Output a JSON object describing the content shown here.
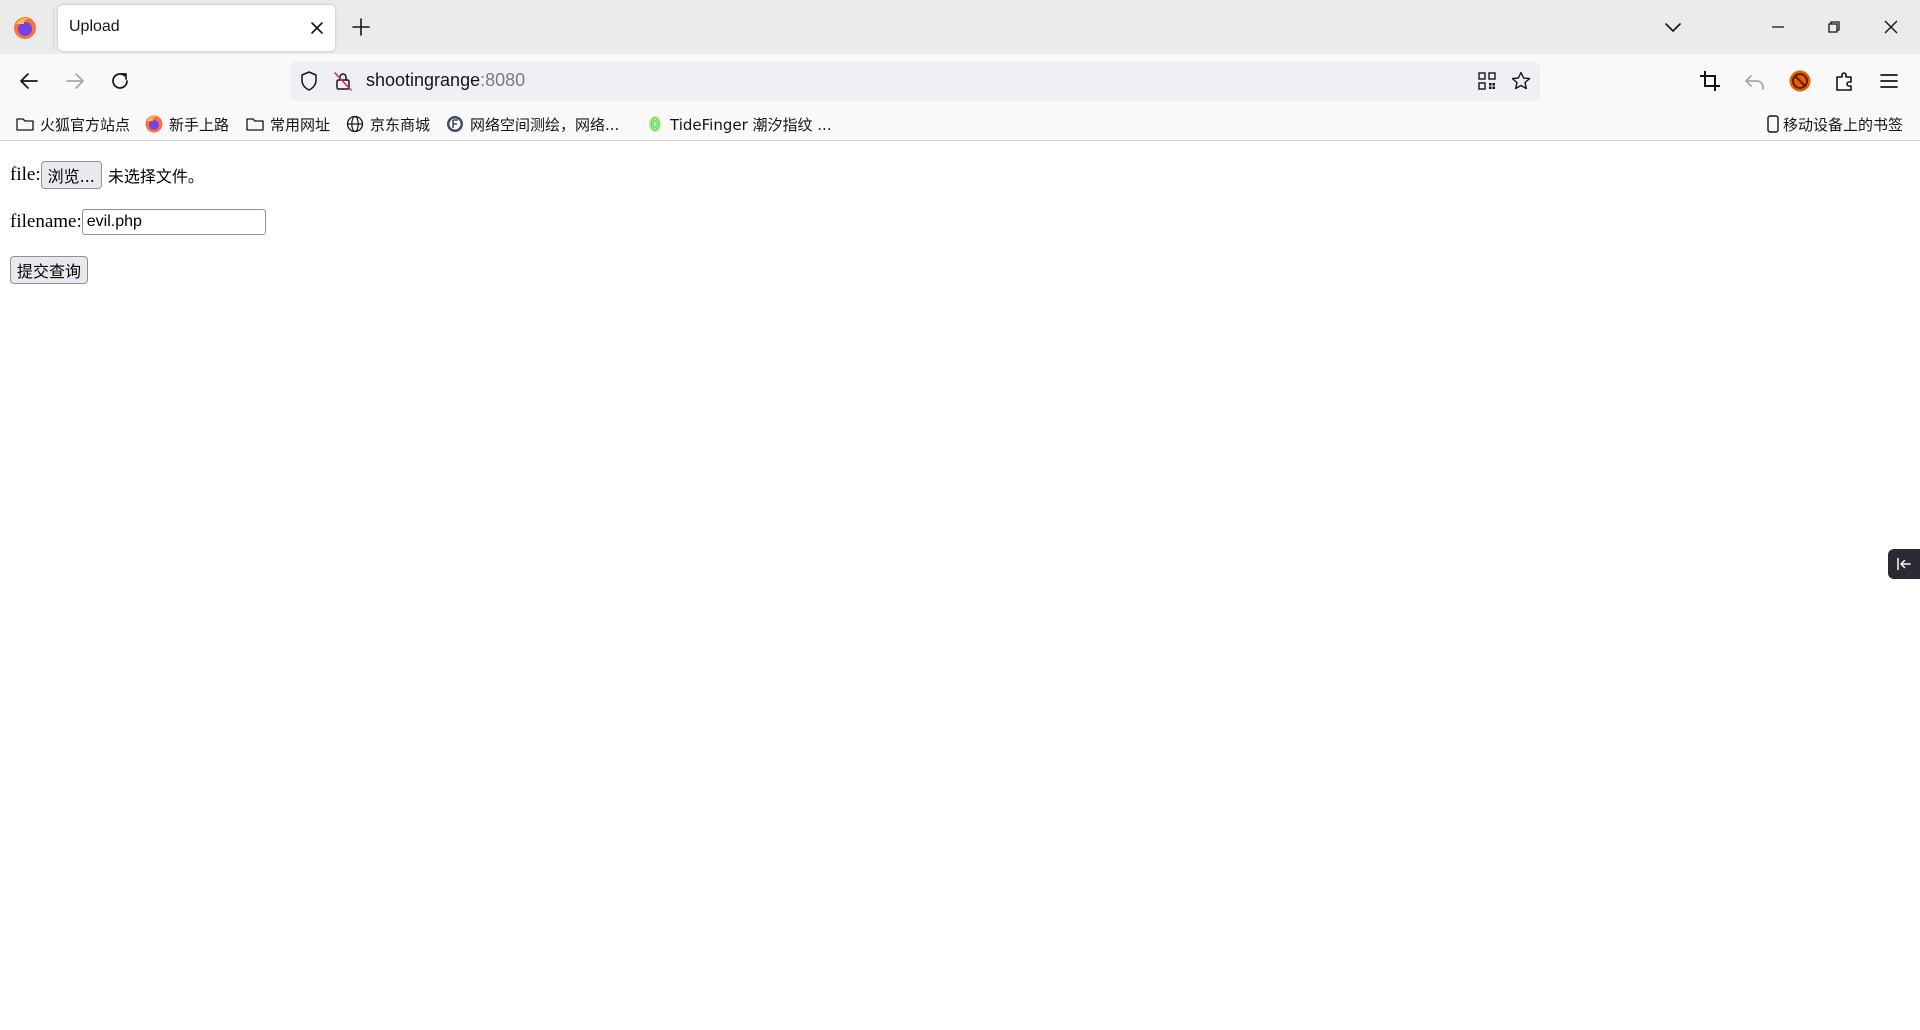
{
  "browser": {
    "tab": {
      "title": "Upload"
    },
    "url": {
      "host": "shootingrange",
      "port": ":8080"
    },
    "icons": {
      "logo": "firefox-icon",
      "tab_close": "close-icon",
      "new_tab": "plus-icon",
      "list_tabs": "chevron-down-icon",
      "minimize": "minimize-icon",
      "restore": "restore-icon",
      "close_window": "close-icon",
      "back": "back-arrow-icon",
      "forward": "forward-arrow-icon",
      "reload": "reload-icon",
      "shield": "shield-icon",
      "insecure": "lock-slash-icon",
      "qr": "qr-code-icon",
      "star": "star-icon",
      "screenshot": "crop-icon",
      "undo": "undo-icon",
      "extension_badge": "extension-badge-icon",
      "extensions": "puzzle-icon",
      "menu": "hamburger-menu-icon",
      "sidebar": "sidebar-collapse-icon"
    },
    "accent_color": "#e66000"
  },
  "bookmarks": {
    "items": [
      {
        "label": "火狐官方站点",
        "icon": "folder-icon"
      },
      {
        "label": "新手上路",
        "icon": "firefox-icon"
      },
      {
        "label": "常用网址",
        "icon": "folder-icon"
      },
      {
        "label": "京东商城",
        "icon": "globe-icon"
      },
      {
        "label": "网络空间测绘，网络...",
        "icon": "fofa-icon"
      },
      {
        "label": "TideFinger 潮汐指纹 ...",
        "icon": "fingerprint-icon"
      }
    ],
    "mobile": {
      "label": "移动设备上的书签",
      "icon": "mobile-icon"
    }
  },
  "form": {
    "file_label": "file:",
    "browse_button": "浏览...",
    "no_file_text": "未选择文件。",
    "filename_label": "filename:",
    "filename_value": "evil.php",
    "submit_button": "提交查询"
  }
}
